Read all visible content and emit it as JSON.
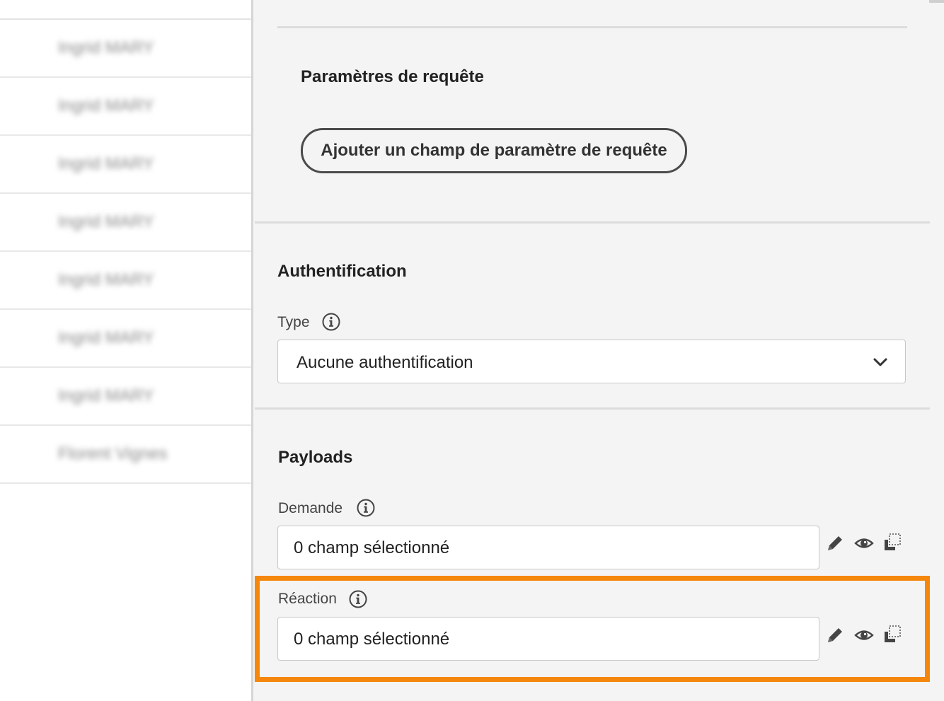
{
  "sidebar": {
    "items": [
      {
        "name": "Ingrid MARY"
      },
      {
        "name": "Ingrid MARY"
      },
      {
        "name": "Ingrid MARY"
      },
      {
        "name": "Ingrid MARY"
      },
      {
        "name": "Ingrid MARY"
      },
      {
        "name": "Ingrid MARY"
      },
      {
        "name": "Ingrid MARY"
      },
      {
        "name": "Florent Vignes"
      }
    ]
  },
  "query_params": {
    "title": "Paramètres de requête",
    "add_button_label": "Ajouter un champ de paramètre de requête"
  },
  "authentication": {
    "title": "Authentification",
    "type_label": "Type",
    "type_value": "Aucune authentification"
  },
  "payloads": {
    "title": "Payloads",
    "request": {
      "label": "Demande",
      "value": "0 champ sélectionné"
    },
    "response": {
      "label": "Réaction",
      "value": "0 champ sélectionné"
    }
  },
  "colors": {
    "highlight": "#f5870d",
    "background": "#f4f4f4"
  },
  "icons": [
    "info-icon",
    "chevron-down-icon",
    "pencil-icon",
    "eye-icon",
    "copy-icon"
  ]
}
